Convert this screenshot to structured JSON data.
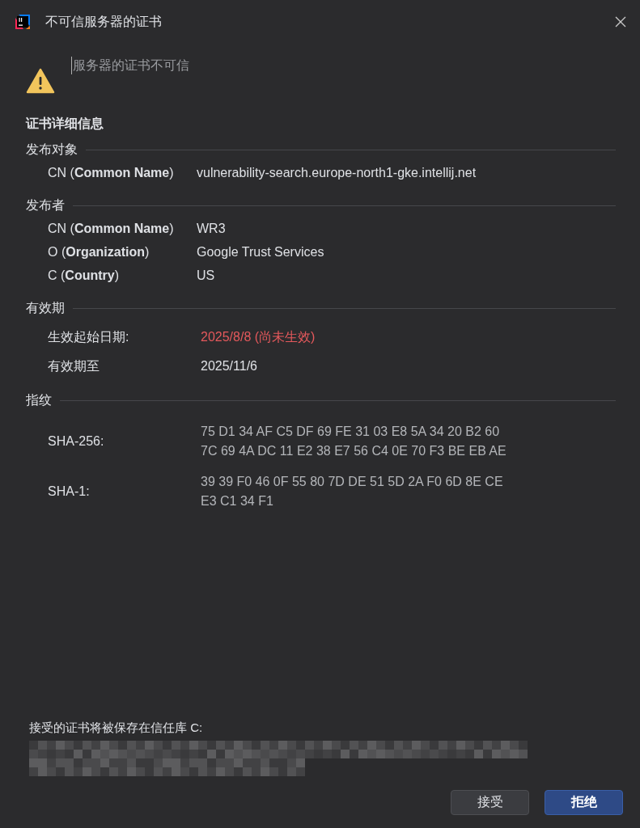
{
  "window": {
    "title": "不可信服务器的证书"
  },
  "message": "服务器的证书不可信",
  "details_heading": "证书详细信息",
  "sections": [
    {
      "title": "发布对象",
      "kind": "fields",
      "rows": [
        {
          "label": "CN (**Common Name**)",
          "value": "vulnerability-search.europe-north1-gke.intellij.net"
        }
      ]
    },
    {
      "title": "发布者",
      "kind": "fields",
      "rows": [
        {
          "label": "CN (**Common Name**)",
          "value": "WR3"
        },
        {
          "label": "O (**Organization**)",
          "value": "Google Trust Services"
        },
        {
          "label": "C (**Country**)",
          "value": "US"
        }
      ]
    },
    {
      "title": "有效期",
      "kind": "validity",
      "rows": [
        {
          "label": "生效起始日期:",
          "value": "2025/8/8 (尚未生效)",
          "invalid": true
        },
        {
          "label": "有效期至",
          "value": "2025/11/6",
          "invalid": false
        }
      ]
    },
    {
      "title": "指纹",
      "kind": "fingerprints",
      "rows": [
        {
          "label": "SHA-256:",
          "lines": [
            "75 D1 34 AF C5 DF 69 FE 31 03 E8 5A 34 20 B2 60",
            "7C 69 4A DC 11 E2 38 E7 56 C4 0E 70 F3 BE EB AE"
          ]
        },
        {
          "label": "SHA-1:",
          "lines": [
            "39 39 F0 46 0F 55 80 7D DE 51 5D 2A F0 6D 8E CE",
            "E3 C1 34 F1"
          ]
        }
      ]
    }
  ],
  "truststore_note": "接受的证书将被保存在信任库 C:",
  "buttons": [
    {
      "label": "接受",
      "kind": "secondary"
    },
    {
      "label": "拒绝",
      "kind": "primary"
    }
  ]
}
